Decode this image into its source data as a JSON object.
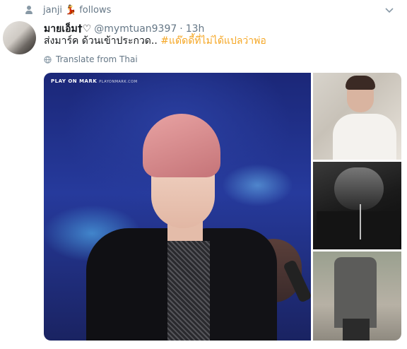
{
  "social_context": {
    "user": "janji",
    "emoji": "💃",
    "action": "follows"
  },
  "tweet": {
    "display_name": "มายเอ็ม†♡",
    "screen_name": "@mymtuan9397",
    "separator": "·",
    "timestamp": "13h",
    "text": "ส่งมาร์ค ด้วนเข้าประกวด..",
    "hashtag": "#แด๊ดดี้ที่ไม่ได้แปลว่าพ่อ",
    "translate": "Translate from Thai"
  },
  "media": {
    "watermark": "PLAY ON MARK",
    "watermark_sub": "PLAYONMARK.COM"
  },
  "colors": {
    "hashtag": "#f5a623",
    "secondary_text": "#657786",
    "primary_text": "#14171a"
  },
  "icons": [
    "person-icon",
    "chevron-down-icon",
    "globe-icon"
  ]
}
